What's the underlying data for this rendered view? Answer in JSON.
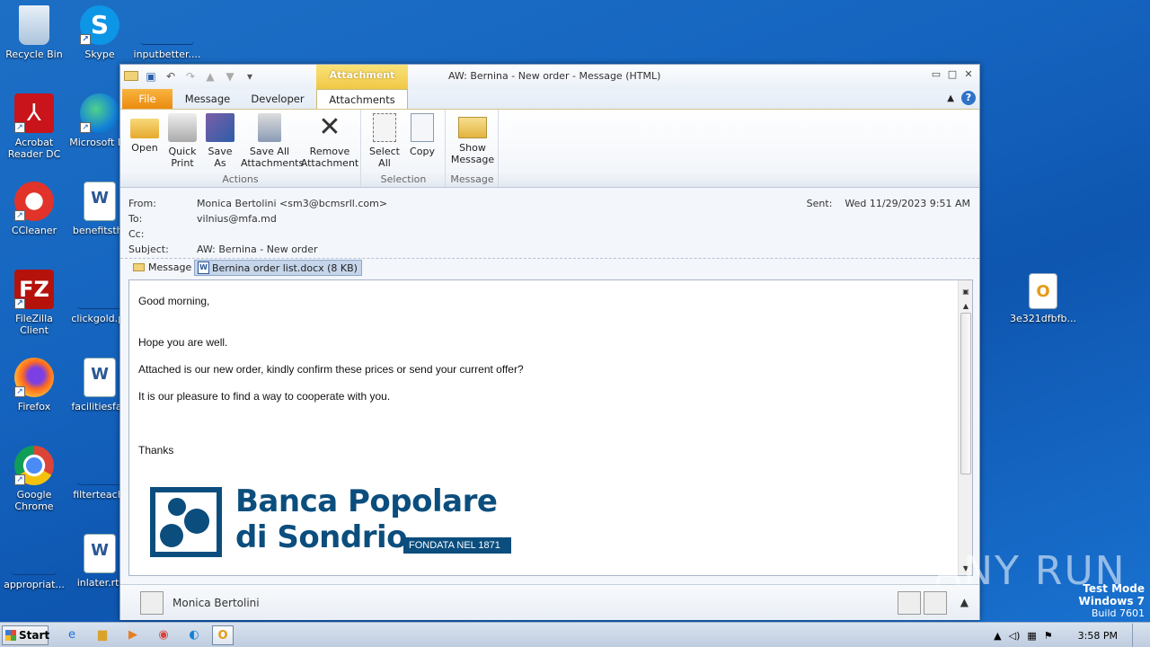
{
  "desktop": {
    "icons": [
      {
        "label": "Recycle Bin"
      },
      {
        "label": "Skype"
      },
      {
        "label": "inputbetter...."
      },
      {
        "label": "Acrobat Reader DC"
      },
      {
        "label": "Microsoft Ed"
      },
      {
        "label": "CCleaner"
      },
      {
        "label": "benefitsthr"
      },
      {
        "label": "FileZilla Client"
      },
      {
        "label": "clickgold.pr"
      },
      {
        "label": "Firefox"
      },
      {
        "label": "facilitiesfan"
      },
      {
        "label": "Google Chrome"
      },
      {
        "label": "filterteachi"
      },
      {
        "label": "appropriat..."
      },
      {
        "label": "inlater.rtf"
      },
      {
        "label": "3e321dfbfb..."
      }
    ]
  },
  "window": {
    "context_tab": "Attachment Tools",
    "title": "AW: Bernina - New order -  Message (HTML)",
    "tabs": {
      "file": "File",
      "message": "Message",
      "developer": "Developer",
      "attachments": "Attachments"
    },
    "ribbon": {
      "actions": {
        "group": "Actions",
        "open": "Open",
        "quick_print_1": "Quick",
        "quick_print_2": "Print",
        "save_as_1": "Save",
        "save_as_2": "As",
        "save_all_1": "Save All",
        "save_all_2": "Attachments",
        "remove_1": "Remove",
        "remove_2": "Attachment"
      },
      "selection": {
        "group": "Selection",
        "select_all_1": "Select",
        "select_all_2": "All",
        "copy": "Copy"
      },
      "message": {
        "group": "Message",
        "show_1": "Show",
        "show_2": "Message"
      }
    },
    "header": {
      "from_label": "From:",
      "from_value": "Monica Bertolini <sm3@bcmsrll.com>",
      "to_label": "To:",
      "to_value": "vilnius@mfa.md",
      "cc_label": "Cc:",
      "subject_label": "Subject:",
      "subject_value": "AW: Bernina - New order",
      "sent_label": "Sent:",
      "sent_value": "Wed 11/29/2023 9:51 AM"
    },
    "attachments": {
      "message_tab": "Message",
      "file": "Bernina order list.docx (8 KB)"
    },
    "body": {
      "greeting": "Good morning,",
      "line1": "Hope you are well.",
      "line2": "Attached is our new order, kindly confirm these prices or send your current offer?",
      "line3": "It is our pleasure to find a way to cooperate with you.",
      "thanks": "Thanks"
    },
    "logo": {
      "line1": "Banca Popolare",
      "line2": "di Sondrio",
      "tag": "FONDATA NEL 1871"
    },
    "people_pane": {
      "name": "Monica Bertolini"
    }
  },
  "taskbar": {
    "start": "Start",
    "clock": "3:58 PM"
  },
  "watermark": {
    "line1": "Test Mode",
    "line2": "Windows 7",
    "line3": "Build 7601",
    "brand": "ANY RUN"
  },
  "colors": {
    "desktop": "#1565c0",
    "file_tab": "#ec8a0e",
    "context_tab": "#f1c845",
    "logo": "#0b4e7e"
  }
}
